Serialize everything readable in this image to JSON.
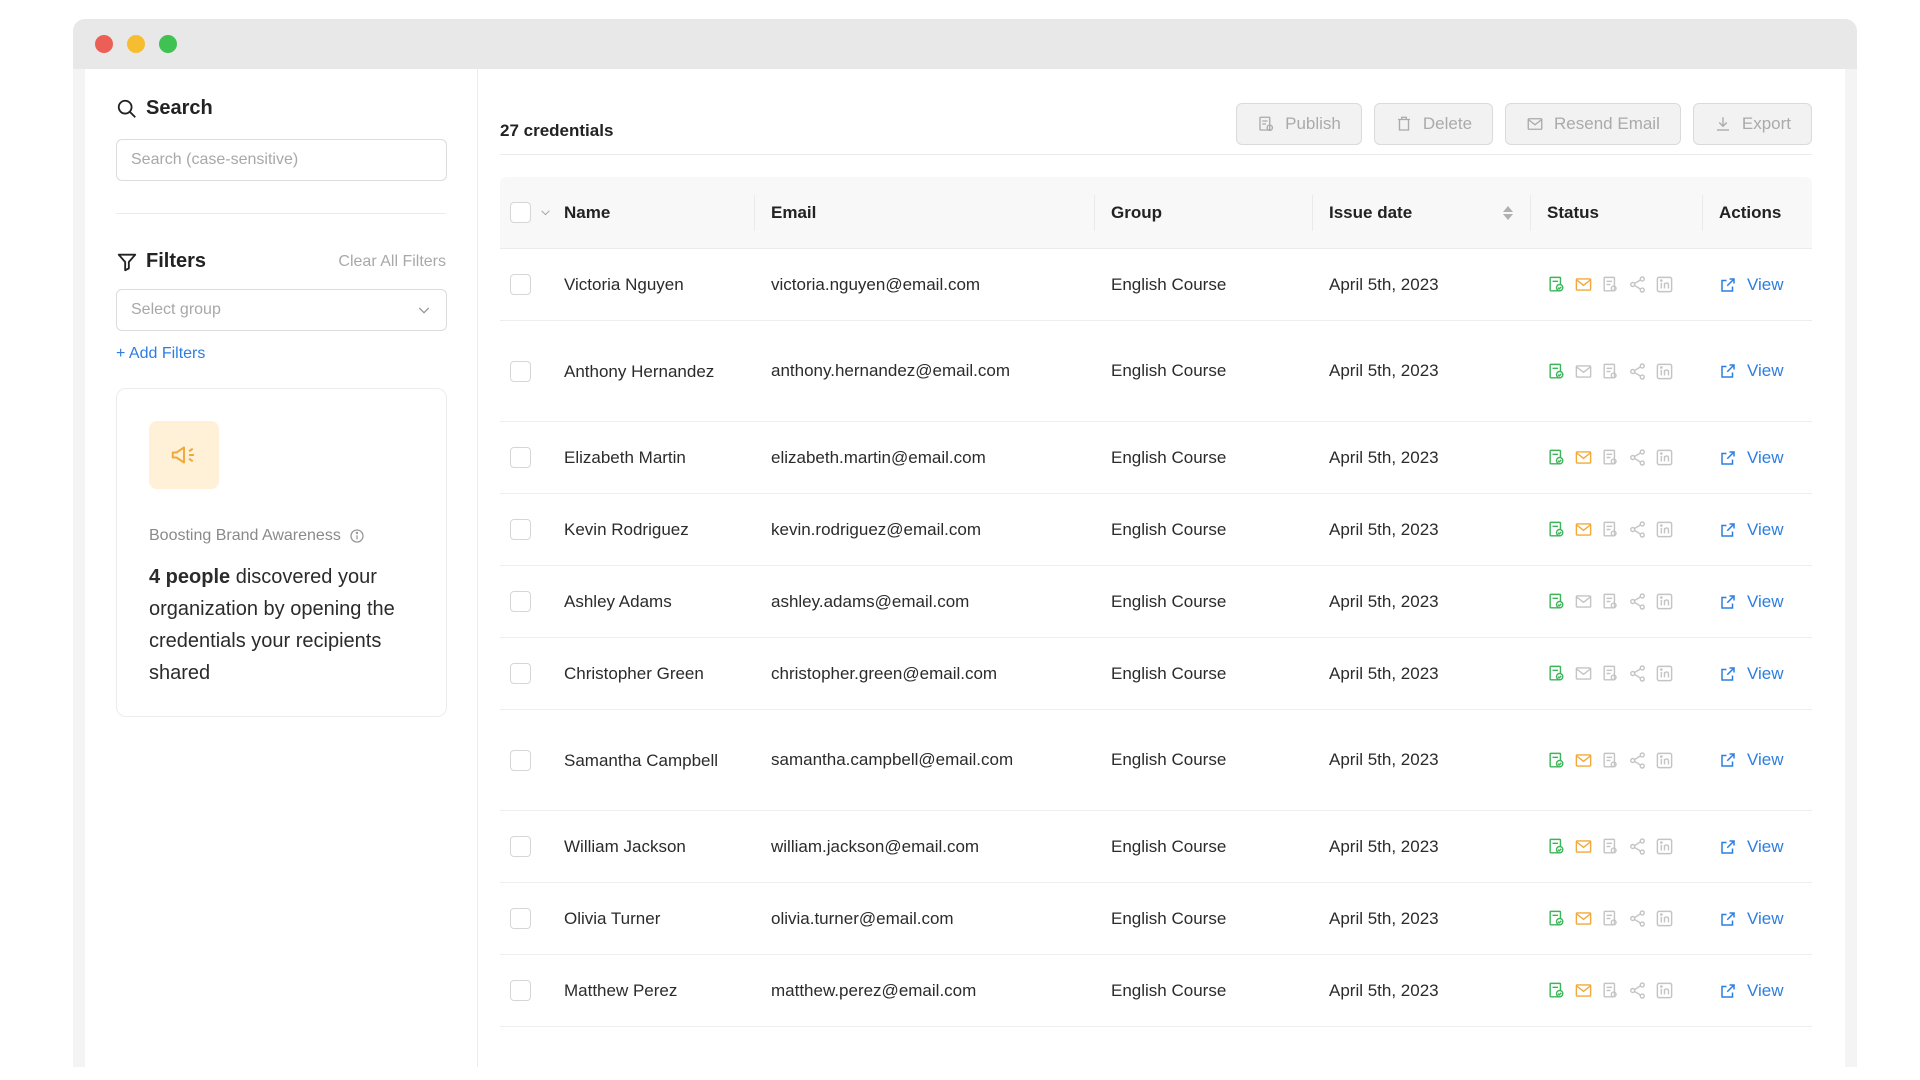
{
  "window": {
    "colors": {
      "close": "#ec5f57",
      "minimize": "#f5bd2f",
      "maximize": "#3fc251"
    }
  },
  "sidebar": {
    "search_title": "Search",
    "search_placeholder": "Search (case-sensitive)",
    "filters_title": "Filters",
    "clear_filters": "Clear All Filters",
    "group_placeholder": "Select group",
    "add_filters": "+ Add Filters",
    "card": {
      "label": "Boosting Brand Awareness",
      "highlight": "4 people",
      "text": " discovered your organization by opening the credentials your recipients shared"
    }
  },
  "main": {
    "count_label": "27 credentials",
    "buttons": {
      "publish": "Publish",
      "delete": "Delete",
      "resend": "Resend Email",
      "export": "Export"
    },
    "columns": {
      "name": "Name",
      "email": "Email",
      "group": "Group",
      "issue_date": "Issue date",
      "status": "Status",
      "actions": "Actions"
    },
    "view_label": "View",
    "colors": {
      "accent": "#2d7ee0",
      "status_green": "#3cb45a",
      "status_orange": "#f2a93b",
      "status_gray": "#c4c4c4"
    },
    "rows": [
      {
        "name": "Victoria Nguyen",
        "email": "victoria.nguyen@email.com",
        "group": "English Course",
        "date": "April 5th, 2023",
        "email_sent": true
      },
      {
        "name": "Anthony Hernandez",
        "email": "anthony.hernandez@email.com",
        "group": "English Course",
        "date": "April 5th, 2023",
        "email_sent": false
      },
      {
        "name": "Elizabeth Martin",
        "email": "elizabeth.martin@email.com",
        "group": "English Course",
        "date": "April 5th, 2023",
        "email_sent": true
      },
      {
        "name": "Kevin Rodriguez",
        "email": "kevin.rodriguez@email.com",
        "group": "English Course",
        "date": "April 5th, 2023",
        "email_sent": true
      },
      {
        "name": "Ashley Adams",
        "email": "ashley.adams@email.com",
        "group": "English Course",
        "date": "April 5th, 2023",
        "email_sent": false
      },
      {
        "name": "Christopher Green",
        "email": "christopher.green@email.com",
        "group": "English Course",
        "date": "April 5th, 2023",
        "email_sent": false
      },
      {
        "name": "Samantha Campbell",
        "email": "samantha.campbell@email.com",
        "group": "English Course",
        "date": "April 5th, 2023",
        "email_sent": true
      },
      {
        "name": "William Jackson",
        "email": "william.jackson@email.com",
        "group": "English Course",
        "date": "April 5th, 2023",
        "email_sent": true
      },
      {
        "name": "Olivia Turner",
        "email": "olivia.turner@email.com",
        "group": "English Course",
        "date": "April 5th, 2023",
        "email_sent": true
      },
      {
        "name": "Matthew Perez",
        "email": "matthew.perez@email.com",
        "group": "English Course",
        "date": "April 5th, 2023",
        "email_sent": true
      }
    ]
  }
}
